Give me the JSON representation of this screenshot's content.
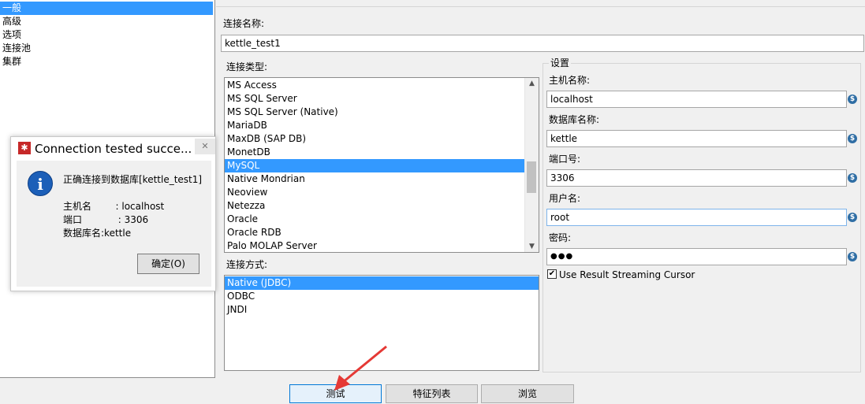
{
  "nav": {
    "items": [
      "一般",
      "高级",
      "选项",
      "连接池",
      "集群"
    ],
    "selected": 0
  },
  "connection_name": {
    "label": "连接名称:",
    "value": "kettle_test1"
  },
  "connection_type": {
    "label": "连接类型:",
    "items": [
      "MS Access",
      "MS SQL Server",
      "MS SQL Server (Native)",
      "MariaDB",
      "MaxDB (SAP DB)",
      "MonetDB",
      "MySQL",
      "Native Mondrian",
      "Neoview",
      "Netezza",
      "Oracle",
      "Oracle RDB",
      "Palo MOLAP Server"
    ],
    "selected": 6
  },
  "access_method": {
    "label": "连接方式:",
    "items": [
      "Native (JDBC)",
      "ODBC",
      "JNDI"
    ],
    "selected": 0
  },
  "settings": {
    "title": "设置",
    "host_label": "主机名称:",
    "host_value": "localhost",
    "db_label": "数据库名称:",
    "db_value": "kettle",
    "port_label": "端口号:",
    "port_value": "3306",
    "user_label": "用户名:",
    "user_value": "root",
    "password_label": "密码:",
    "password_value": "●●●",
    "streaming_label": "Use Result Streaming Cursor",
    "streaming_checked": true
  },
  "buttons": {
    "test": "测试",
    "features": "特征列表",
    "browse": "浏览"
  },
  "dialog": {
    "title": "Connection tested succe...",
    "close": "✕",
    "message": "正确连接到数据库[kettle_test1]",
    "host_line": "主机名        : localhost",
    "port_line": "端口            : 3306",
    "db_line": "数据库名:kettle",
    "ok": "确定(O)"
  },
  "colors": {
    "selection": "#3399ff",
    "annotation_arrow": "#e53935",
    "dialog_icon": "#1c5fb8"
  }
}
